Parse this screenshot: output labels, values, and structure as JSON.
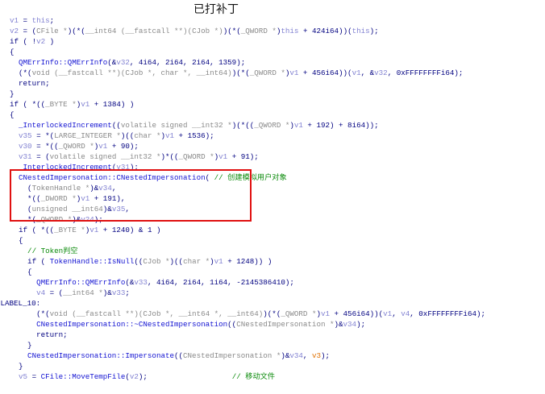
{
  "title": "已打补丁",
  "highlight_color": "#e01010",
  "code": [
    {
      "s": [
        [
          "v1",
          "v"
        ],
        [
          " = ",
          "n"
        ],
        [
          "this",
          "v"
        ],
        [
          ";",
          "n"
        ]
      ]
    },
    {
      "s": [
        [
          "v2",
          "v"
        ],
        [
          " = (",
          "n"
        ],
        [
          "CFile *",
          "t"
        ],
        [
          ")(*(",
          "n"
        ],
        [
          "__int64 (__fastcall **)(CJob *)",
          "t"
        ],
        [
          ")(*(",
          "n"
        ],
        [
          "_QWORD *",
          "t"
        ],
        [
          ")",
          "n"
        ],
        [
          "this",
          "v"
        ],
        [
          " + 424i64))(",
          "n"
        ],
        [
          "this",
          "v"
        ],
        [
          ");",
          "n"
        ]
      ]
    },
    {
      "s": [
        [
          "if ( !",
          "n"
        ],
        [
          "v2",
          "v"
        ],
        [
          " )",
          "n"
        ]
      ]
    },
    {
      "s": [
        [
          "{",
          "n"
        ]
      ]
    },
    {
      "s": [
        [
          "  QMErrInfo::QMErrInfo",
          "f"
        ],
        [
          "(&",
          "n"
        ],
        [
          "v32",
          "v"
        ],
        [
          ", 4i64, 2i64, 2i64, 1359);",
          "n"
        ]
      ]
    },
    {
      "s": [
        [
          "  (*(",
          "n"
        ],
        [
          "void (__fastcall **)(CJob *, char *, __int64)",
          "t"
        ],
        [
          ")(*(",
          "n"
        ],
        [
          "_QWORD *",
          "t"
        ],
        [
          ")",
          "n"
        ],
        [
          "v1",
          "v"
        ],
        [
          " + 456i64))(",
          "n"
        ],
        [
          "v1",
          "v"
        ],
        [
          ", &",
          "n"
        ],
        [
          "v32",
          "v"
        ],
        [
          ", 0xFFFFFFFFi64);",
          "n"
        ]
      ]
    },
    {
      "s": [
        [
          "  return;",
          "n"
        ]
      ]
    },
    {
      "s": [
        [
          "}",
          "n"
        ]
      ]
    },
    {
      "s": [
        [
          "if ( *((",
          "n"
        ],
        [
          "_BYTE *",
          "t"
        ],
        [
          ")",
          "n"
        ],
        [
          "v1",
          "v"
        ],
        [
          " + 1384) )",
          "n"
        ]
      ]
    },
    {
      "s": [
        [
          "{",
          "n"
        ]
      ]
    },
    {
      "s": [
        [
          "  _InterlockedIncrement",
          "f"
        ],
        [
          "((",
          "n"
        ],
        [
          "volatile signed __int32 *",
          "t"
        ],
        [
          ")(*((",
          "n"
        ],
        [
          "_QWORD *",
          "t"
        ],
        [
          ")",
          "n"
        ],
        [
          "v1",
          "v"
        ],
        [
          " + 192) + 8i64));",
          "n"
        ]
      ]
    },
    {
      "s": [
        [
          "  v35",
          "v"
        ],
        [
          " = *(",
          "n"
        ],
        [
          "LARGE_INTEGER *",
          "t"
        ],
        [
          ")((",
          "n"
        ],
        [
          "char *",
          "t"
        ],
        [
          ")",
          "n"
        ],
        [
          "v1",
          "v"
        ],
        [
          " + 1536);",
          "n"
        ]
      ]
    },
    {
      "s": [
        [
          "  v30",
          "v"
        ],
        [
          " = *((",
          "n"
        ],
        [
          "_QWORD *",
          "t"
        ],
        [
          ")",
          "n"
        ],
        [
          "v1",
          "v"
        ],
        [
          " + 90);",
          "n"
        ]
      ]
    },
    {
      "s": [
        [
          "  v31",
          "v"
        ],
        [
          " = (",
          "n"
        ],
        [
          "volatile signed __int32 *",
          "t"
        ],
        [
          ")*((",
          "n"
        ],
        [
          "_QWORD *",
          "t"
        ],
        [
          ")",
          "n"
        ],
        [
          "v1",
          "v"
        ],
        [
          " + 91);",
          "n"
        ]
      ]
    },
    {
      "s": [
        [
          "  _InterlockedIncrement",
          "f"
        ],
        [
          "(",
          "n"
        ],
        [
          "v31",
          "v"
        ],
        [
          ");",
          "n"
        ]
      ]
    },
    {
      "s": [
        [
          "  CNestedImpersonation::CNestedImpersonation",
          "f"
        ],
        [
          "( ",
          "n"
        ],
        [
          "// 创建模拟用户对象",
          "c"
        ]
      ]
    },
    {
      "s": [
        [
          "    (",
          "n"
        ],
        [
          "TokenHandle *",
          "t"
        ],
        [
          ")&",
          "n"
        ],
        [
          "v34",
          "v"
        ],
        [
          ",",
          "n"
        ]
      ]
    },
    {
      "s": [
        [
          "    *((",
          "n"
        ],
        [
          "_DWORD *",
          "t"
        ],
        [
          ")",
          "n"
        ],
        [
          "v1",
          "v"
        ],
        [
          " + 191),",
          "n"
        ]
      ]
    },
    {
      "s": [
        [
          "    (",
          "n"
        ],
        [
          "unsigned __int64",
          "t"
        ],
        [
          ")&",
          "n"
        ],
        [
          "v35",
          "v"
        ],
        [
          ",",
          "n"
        ]
      ]
    },
    {
      "s": [
        [
          "    *(",
          "n"
        ],
        [
          "_QWORD *",
          "t"
        ],
        [
          ")&",
          "n"
        ],
        [
          "v24",
          "v"
        ],
        [
          ");",
          "n"
        ]
      ]
    },
    {
      "s": [
        [
          "  if ( *((",
          "n"
        ],
        [
          "_BYTE *",
          "t"
        ],
        [
          ")",
          "n"
        ],
        [
          "v1",
          "v"
        ],
        [
          " + 1240) & 1 )",
          "n"
        ]
      ]
    },
    {
      "s": [
        [
          "  {",
          "n"
        ]
      ]
    },
    {
      "s": [
        [
          "    // Token判空",
          "c"
        ]
      ]
    },
    {
      "s": [
        [
          "    if ( ",
          "n"
        ],
        [
          "TokenHandle::IsNull",
          "f"
        ],
        [
          "((",
          "n"
        ],
        [
          "CJob *",
          "t"
        ],
        [
          ")((",
          "n"
        ],
        [
          "char *",
          "t"
        ],
        [
          ")",
          "n"
        ],
        [
          "v1",
          "v"
        ],
        [
          " + 1248)) )",
          "n"
        ]
      ]
    },
    {
      "s": [
        [
          "    {",
          "n"
        ]
      ]
    },
    {
      "s": [
        [
          "      QMErrInfo::QMErrInfo",
          "f"
        ],
        [
          "(&",
          "n"
        ],
        [
          "v33",
          "v"
        ],
        [
          ", 4i64, 2i64, 1i64, -2145386410);",
          "n"
        ]
      ]
    },
    {
      "s": [
        [
          "      v4",
          "v"
        ],
        [
          " = (",
          "n"
        ],
        [
          "__int64 *",
          "t"
        ],
        [
          ")&",
          "n"
        ],
        [
          "v33",
          "v"
        ],
        [
          ";",
          "n"
        ]
      ]
    },
    {
      "label": true,
      "s": [
        [
          "LABEL_10:",
          "n"
        ]
      ]
    },
    {
      "s": [
        [
          "      (*(",
          "n"
        ],
        [
          "void (__fastcall **)(CJob *, __int64 *, __int64)",
          "t"
        ],
        [
          ")(*(",
          "n"
        ],
        [
          "_QWORD *",
          "t"
        ],
        [
          ")",
          "n"
        ],
        [
          "v1",
          "v"
        ],
        [
          " + 456i64))(",
          "n"
        ],
        [
          "v1",
          "v"
        ],
        [
          ", ",
          "n"
        ],
        [
          "v4",
          "v"
        ],
        [
          ", 0xFFFFFFFFi64);",
          "n"
        ]
      ]
    },
    {
      "s": [
        [
          "      CNestedImpersonation::~CNestedImpersonation",
          "f"
        ],
        [
          "((",
          "n"
        ],
        [
          "CNestedImpersonation *",
          "t"
        ],
        [
          ")&",
          "n"
        ],
        [
          "v34",
          "v"
        ],
        [
          ");",
          "n"
        ]
      ]
    },
    {
      "s": [
        [
          "      return;",
          "n"
        ]
      ]
    },
    {
      "s": [
        [
          "    }",
          "n"
        ]
      ]
    },
    {
      "s": [
        [
          "    CNestedImpersonation::Impersonate",
          "f"
        ],
        [
          "((",
          "n"
        ],
        [
          "CNestedImpersonation *",
          "t"
        ],
        [
          ")&",
          "n"
        ],
        [
          "v34",
          "v"
        ],
        [
          ", ",
          "n"
        ],
        [
          "v3",
          "o"
        ],
        [
          ");",
          "n"
        ]
      ]
    },
    {
      "s": [
        [
          "  }",
          "n"
        ]
      ]
    },
    {
      "s": [
        [
          "  v5",
          "v"
        ],
        [
          " = ",
          "n"
        ],
        [
          "CFile::MoveTempFile",
          "f"
        ],
        [
          "(",
          "n"
        ],
        [
          "v2",
          "v"
        ],
        [
          ");                   ",
          "n"
        ],
        [
          "// 移动文件",
          "c"
        ]
      ]
    }
  ]
}
